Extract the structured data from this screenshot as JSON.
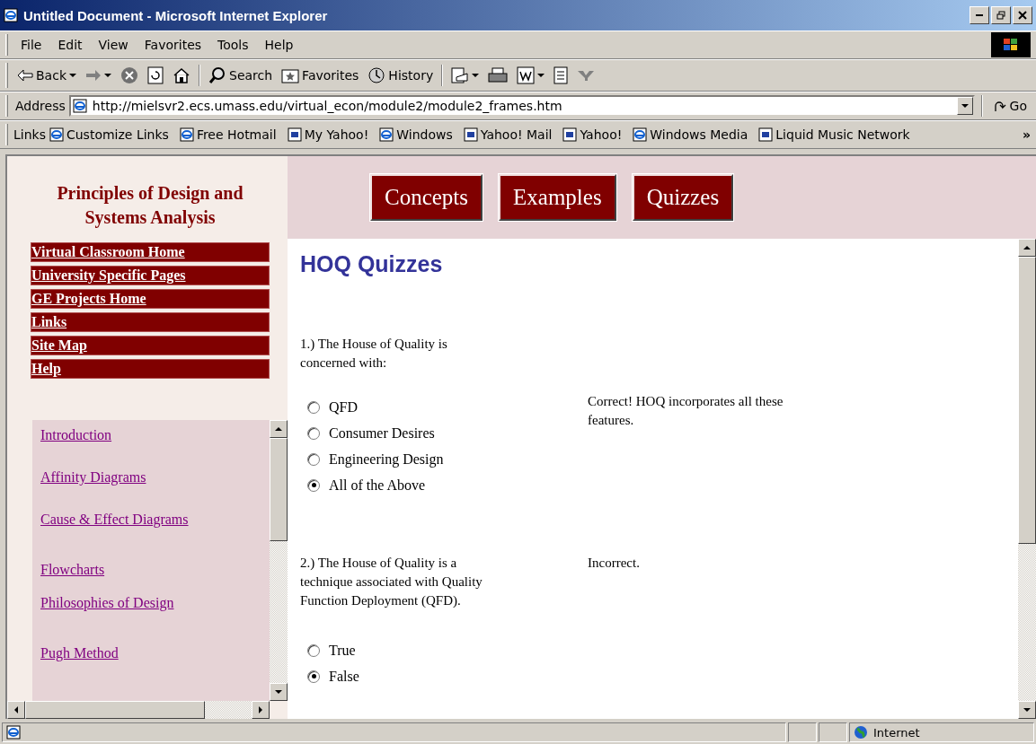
{
  "window": {
    "title": "Untitled Document - Microsoft Internet Explorer"
  },
  "menu": [
    "File",
    "Edit",
    "View",
    "Favorites",
    "Tools",
    "Help"
  ],
  "toolbar": [
    {
      "kind": "back",
      "label": "Back",
      "dropdown": true
    },
    {
      "kind": "forward",
      "dropdown": true
    },
    {
      "kind": "stop"
    },
    {
      "kind": "refresh"
    },
    {
      "kind": "home"
    },
    {
      "kind": "separator"
    },
    {
      "kind": "search",
      "label": "Search"
    },
    {
      "kind": "favorites",
      "label": "Favorites"
    },
    {
      "kind": "history",
      "label": "History"
    },
    {
      "kind": "separator"
    },
    {
      "kind": "mail",
      "dropdown": true
    },
    {
      "kind": "print"
    },
    {
      "kind": "edit",
      "dropdown": true
    },
    {
      "kind": "discuss"
    },
    {
      "kind": "messenger"
    }
  ],
  "address": {
    "label": "Address",
    "value": "http://mielsvr2.ecs.umass.edu/virtual_econ/module2/module2_frames.htm",
    "go": "Go"
  },
  "links": {
    "label": "Links",
    "items": [
      "Customize Links",
      "Free Hotmail",
      "My Yahoo!",
      "Windows",
      "Yahoo! Mail",
      "Yahoo!",
      "Windows Media",
      "Liquid Music Network"
    ],
    "more": "»"
  },
  "sidebar": {
    "title": "Principles of Design and Systems Analysis",
    "nav": [
      "Virtual Classroom Home",
      "University Specific Pages",
      "GE Projects Home",
      "Links",
      "Site Map",
      "Help"
    ],
    "topics": [
      "Introduction",
      "Affinity Diagrams",
      "Cause & Effect Diagrams",
      "Flowcharts",
      "Philosophies of Design",
      "Pugh Method"
    ]
  },
  "top_nav": [
    "Concepts",
    "Examples",
    "Quizzes"
  ],
  "quiz": {
    "title": "HOQ Quizzes",
    "questions": [
      {
        "text": "1.) The House of Quality is concerned with:",
        "options": [
          {
            "label": "QFD",
            "selected": false
          },
          {
            "label": "Consumer Desires",
            "selected": false
          },
          {
            "label": "Engineering Design",
            "selected": false
          },
          {
            "label": "All of the Above",
            "selected": true
          }
        ],
        "feedback": "Correct! HOQ incorporates all these features."
      },
      {
        "text": "2.) The House of Quality is a technique associated with Quality Function Deployment (QFD).",
        "options": [
          {
            "label": "True",
            "selected": false
          },
          {
            "label": "False",
            "selected": true
          }
        ],
        "feedback": "Incorrect."
      }
    ]
  },
  "status_bar": {
    "zone": "Internet"
  }
}
